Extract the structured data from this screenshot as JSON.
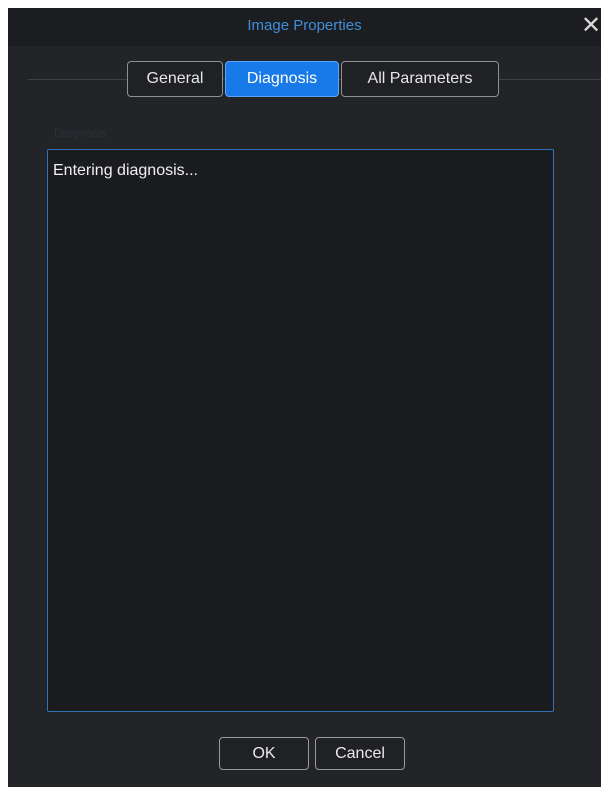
{
  "dialog": {
    "title": "Image Properties",
    "close_icon": "close-icon",
    "close_glyph": "✕"
  },
  "tabs": [
    {
      "label": "General",
      "active": false
    },
    {
      "label": "Diagnosis",
      "active": true
    },
    {
      "label": "All Parameters",
      "active": false
    }
  ],
  "diagnosis": {
    "section_label": "Diagnosis",
    "text": "Entering diagnosis..."
  },
  "buttons": {
    "ok_label": "OK",
    "cancel_label": "Cancel"
  },
  "colors": {
    "accent": "#1879e8",
    "title": "#3f8ed9",
    "background": "#222428"
  }
}
